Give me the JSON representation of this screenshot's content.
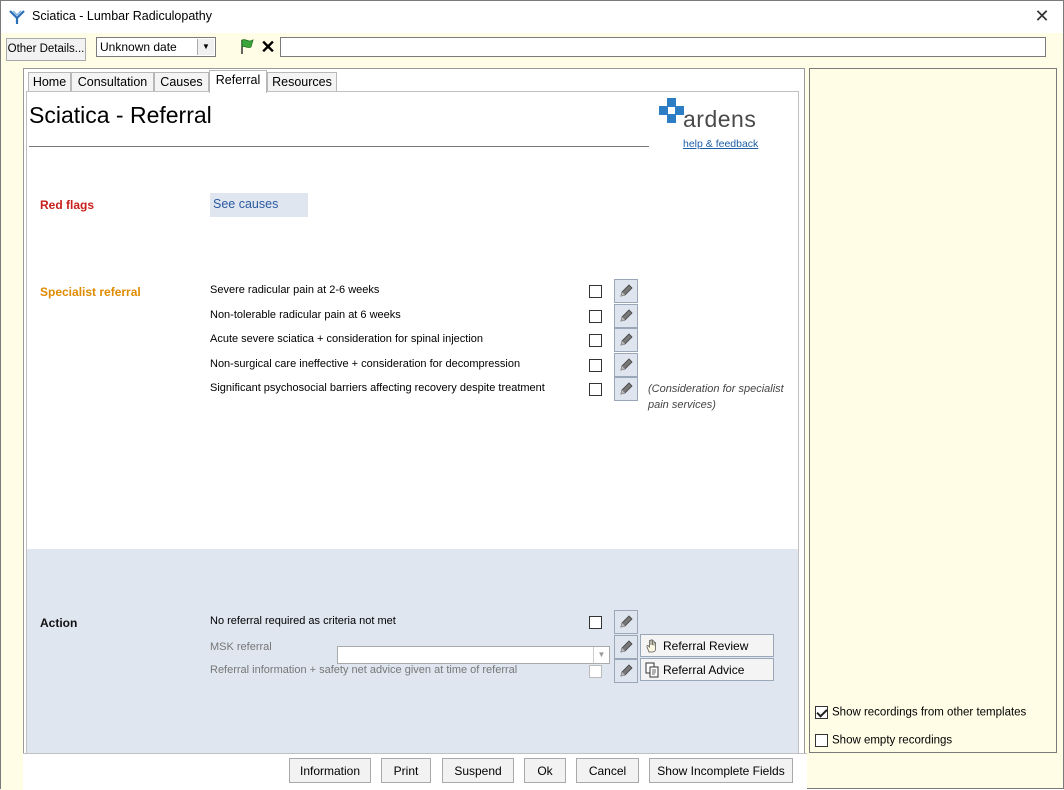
{
  "window": {
    "title": "Sciatica - Lumbar Radiculopathy"
  },
  "toolbar": {
    "other_details_label": "Other Details...",
    "date_value": "Unknown date",
    "note_value": ""
  },
  "tabs": [
    {
      "label": "Home"
    },
    {
      "label": "Consultation"
    },
    {
      "label": "Causes"
    },
    {
      "label": "Referral",
      "active": true
    },
    {
      "label": "Resources"
    }
  ],
  "page": {
    "title": "Sciatica - Referral",
    "logo_text": "ardens",
    "help_link": "help & feedback"
  },
  "red_flags": {
    "label": "Red flags",
    "see_causes": "See causes"
  },
  "specialist": {
    "label": "Specialist referral",
    "items": [
      {
        "label": "Severe radicular pain at 2-6 weeks",
        "checked": false
      },
      {
        "label": "Non-tolerable radicular pain at 6 weeks",
        "checked": false
      },
      {
        "label": "Acute severe sciatica + consideration for spinal injection",
        "checked": false
      },
      {
        "label": "Non-surgical care ineffective + consideration for decompression",
        "checked": false
      },
      {
        "label": "Significant psychosocial barriers affecting recovery despite treatment",
        "checked": false
      }
    ],
    "note": "(Consideration for specialist pain services)"
  },
  "action": {
    "label": "Action",
    "no_referral": "No referral required as criteria not met",
    "msk_label": "MSK referral",
    "msk_value": "",
    "info_label": "Referral information + safety net advice given at time of referral",
    "referral_review": "Referral Review",
    "referral_advice": "Referral Advice"
  },
  "right_panel": {
    "show_other_templates": "Show recordings from other templates",
    "show_other_templates_checked": true,
    "show_empty": "Show empty recordings",
    "show_empty_checked": false
  },
  "buttons": {
    "information": "Information",
    "print": "Print",
    "suspend": "Suspend",
    "ok": "Ok",
    "cancel": "Cancel",
    "show_incomplete": "Show Incomplete Fields"
  },
  "colors": {
    "red_flag": "#c8201c",
    "specialist": "#e08a00",
    "logo_blue": "#2d7dc4",
    "panel_yellow": "#fffde6",
    "action_band": "#dfe6f0"
  }
}
